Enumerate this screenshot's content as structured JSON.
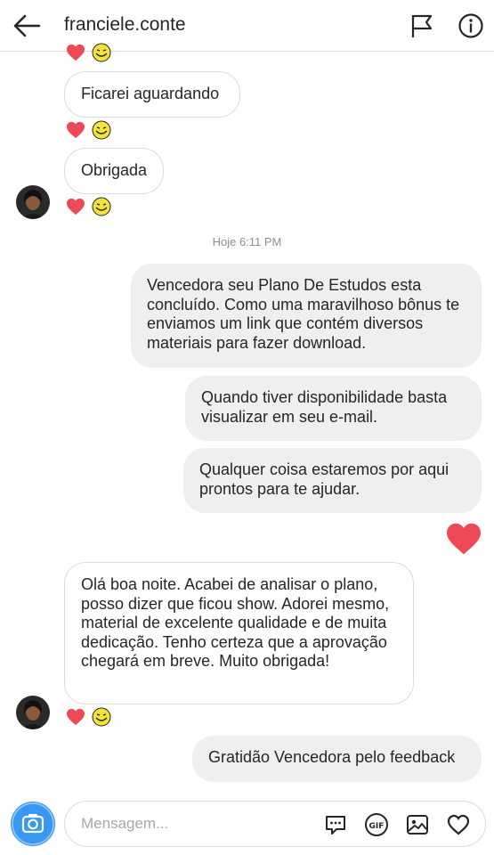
{
  "header": {
    "title": "franciele.conte",
    "icons": [
      "back-arrow-icon",
      "flag-icon",
      "info-icon"
    ]
  },
  "messages": {
    "m1": "Ficarei aguardando",
    "m2": "Obrigada",
    "m3": "Vencedora seu Plano De Estudos esta concluído.  Como uma maravilhoso bônus te enviamos um link que contém diversos materiais para fazer download.",
    "m4": "Quando tiver disponibilidade basta visualizar em seu e-mail.",
    "m5": "Qualquer coisa estaremos por aqui prontos para te ajudar.",
    "m6": "Olá boa noite. Acabei de analisar o plano, posso dizer que ficou show. Adorei mesmo, material de excelente qualidade e de muita dedicação. Tenho certeza que a aprovação chegará em breve. Muito obrigada!",
    "m7": "Gratidão Vencedora pelo feedback"
  },
  "timestamp": "Hoje 6:11 PM",
  "composer": {
    "placeholder": "Mensagem...",
    "icons": [
      "camera-icon",
      "sticker-icon",
      "gif-icon",
      "image-icon",
      "heart-icon"
    ]
  },
  "colors": {
    "heart": "#ed4956",
    "camera_button": "#3897f0",
    "outgoing_bubble": "#efefef",
    "incoming_border": "#dbdbdb"
  }
}
